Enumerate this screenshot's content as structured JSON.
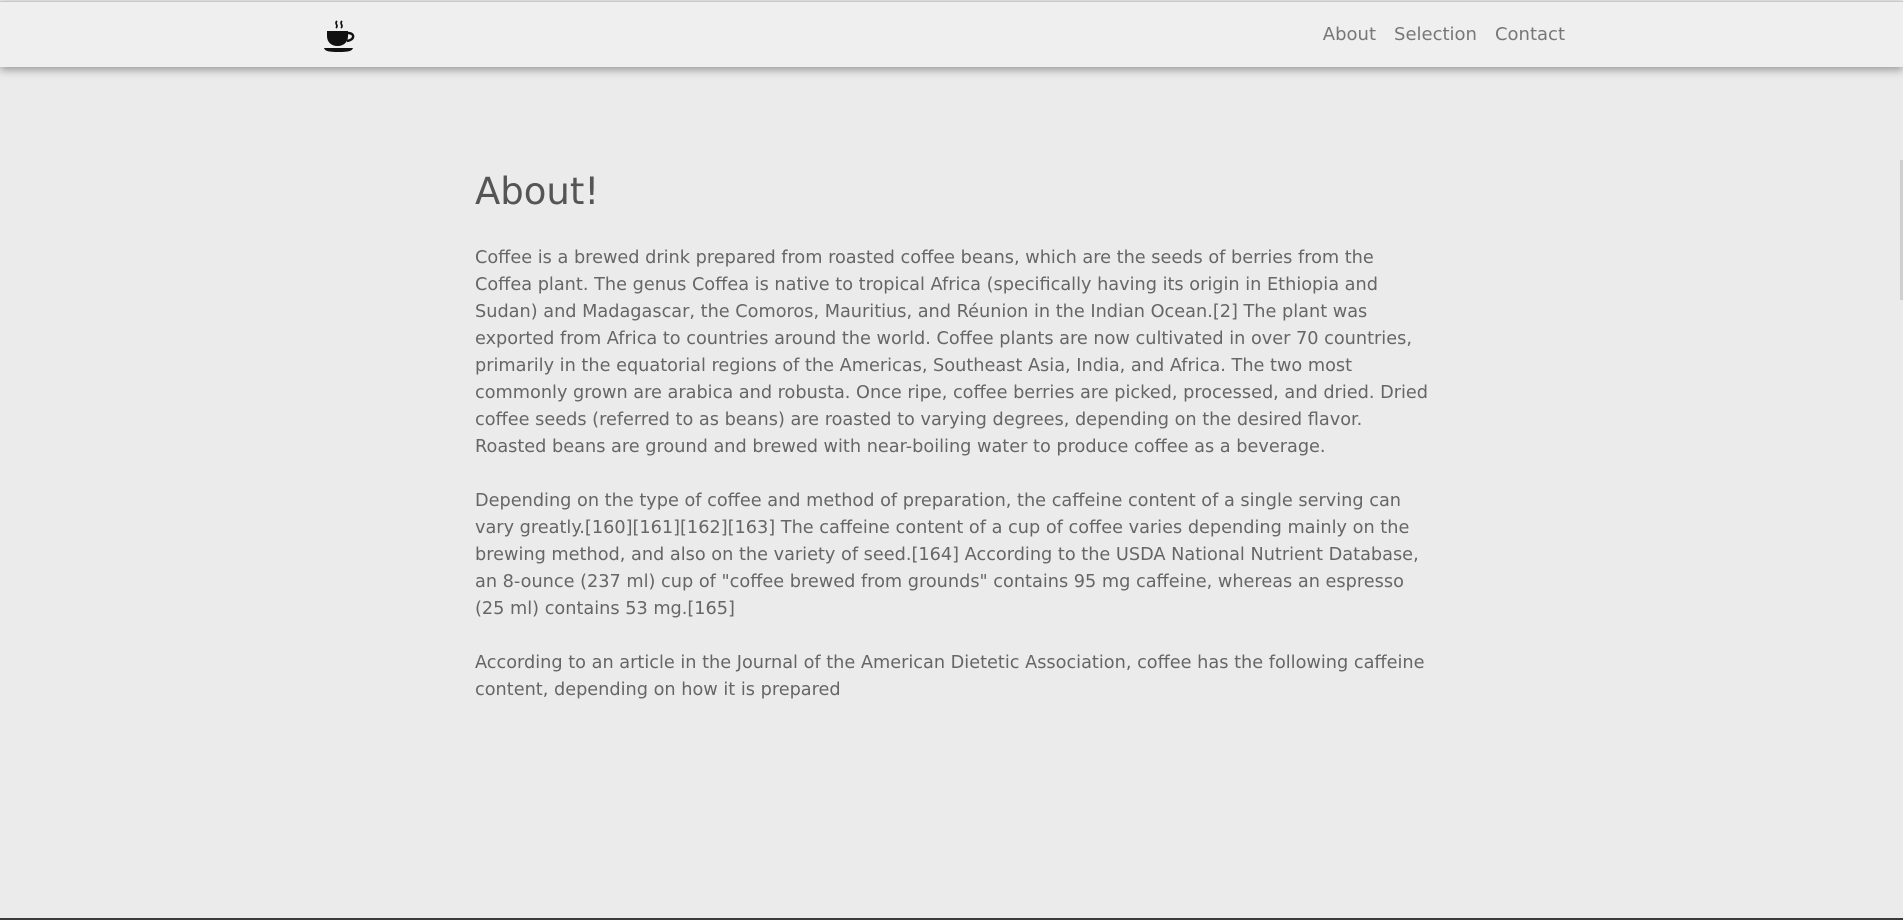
{
  "nav": {
    "logo_icon": "coffee-cup-icon",
    "links": [
      "About",
      "Selection",
      "Contact"
    ]
  },
  "main": {
    "title": "About!",
    "paragraphs": [
      "Coffee is a brewed drink prepared from roasted coffee beans, which are the seeds of berries from the Coffea plant. The genus Coffea is native to tropical Africa (specifically having its origin in Ethiopia and Sudan) and Madagascar, the Comoros, Mauritius, and Réunion in the Indian Ocean.[2] The plant was exported from Africa to countries around the world. Coffee plants are now cultivated in over 70 countries, primarily in the equatorial regions of the Americas, Southeast Asia, India, and Africa. The two most commonly grown are arabica and robusta. Once ripe, coffee berries are picked, processed, and dried. Dried coffee seeds (referred to as beans) are roasted to varying degrees, depending on the desired flavor. Roasted beans are ground and brewed with near-boiling water to produce coffee as a beverage.",
      "Depending on the type of coffee and method of preparation, the caffeine content of a single serving can vary greatly.[160][161][162][163] The caffeine content of a cup of coffee varies depending mainly on the brewing method, and also on the variety of seed.[164] According to the USDA National Nutrient Database, an 8-ounce (237 ml) cup of \"coffee brewed from grounds\" contains 95 mg caffeine, whereas an espresso (25 ml) contains 53 mg.[165]",
      "According to an article in the Journal of the American Dietetic Association, coffee has the following caffeine content, depending on how it is prepared"
    ]
  }
}
